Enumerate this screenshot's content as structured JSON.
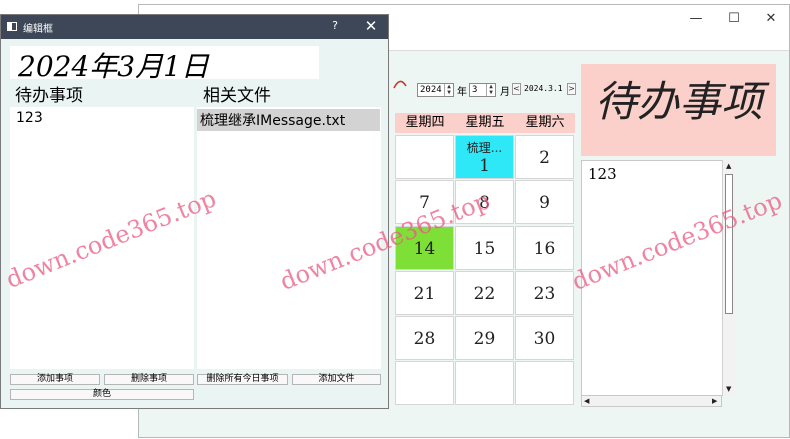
{
  "main_window": {
    "controls": {
      "minimize": "—",
      "maximize": "☐",
      "close": "✕"
    },
    "header": {
      "year_value": "2024",
      "year_unit": "年",
      "month_value": "3",
      "month_unit": "月",
      "prev": "<",
      "current_date": "2024.3.1",
      "next": ">"
    },
    "big_note": "待办事项",
    "weekdays": [
      "星期四",
      "星期五",
      "星期六"
    ],
    "calendar": {
      "row1": {
        "fri_note": "梳理...",
        "fri": "1",
        "sat": "2"
      },
      "row2": {
        "thu": "7",
        "fri": "8",
        "sat": "9"
      },
      "row3": {
        "thu": "14",
        "fri": "15",
        "sat": "16"
      },
      "row4": {
        "thu": "21",
        "fri": "22",
        "sat": "23"
      },
      "row5": {
        "thu": "28",
        "fri": "29",
        "sat": "30"
      }
    },
    "todo_list": [
      "123"
    ],
    "colors": {
      "today": "#7ee037",
      "has_file": "#2ee8f8",
      "header_bg": "#fbd0cb"
    }
  },
  "dialog": {
    "title": "编辑框",
    "help": "?",
    "close": "✕",
    "date": "2024年3月1日",
    "todo_label": "待办事项",
    "files_label": "相关文件",
    "todos": [
      "123"
    ],
    "files": [
      "梳理继承IMessage.txt"
    ],
    "buttons": {
      "add_item": "添加事项",
      "delete_item": "删除事项",
      "delete_all_today": "删除所有今日事项",
      "add_file": "添加文件",
      "color": "颜色"
    }
  },
  "watermark": "down.code365.top"
}
